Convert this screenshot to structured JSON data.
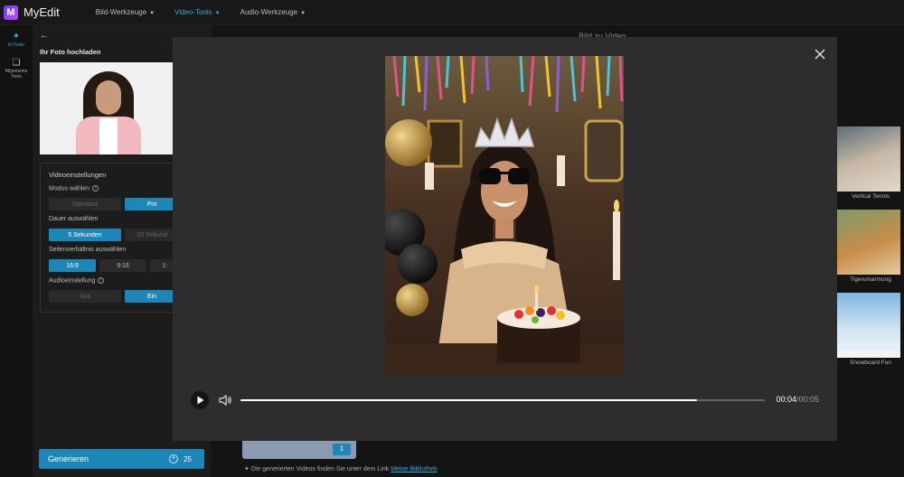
{
  "app": {
    "logo_letter": "M",
    "name": "MyEdit"
  },
  "nav": [
    {
      "label": "Bild-Werkzeuge",
      "active": false
    },
    {
      "label": "Video-Tools",
      "active": true
    },
    {
      "label": "Audio-Werkzeuge",
      "active": false
    }
  ],
  "rail": [
    {
      "label": "KI Tools",
      "icon": "magic-wand-icon",
      "active": true
    },
    {
      "label": "Allgemeine Tools",
      "icon": "layers-icon",
      "active": false
    }
  ],
  "panel": {
    "upload_title": "Ihr Foto hochladen",
    "settings_title": "Videoeinstellungen",
    "mode_label": "Modus wählen",
    "mode_options": [
      "Standard",
      "Pro"
    ],
    "duration_label": "Dauer auswählen",
    "duration_options": [
      "5 Sekunden",
      "10 Sekund"
    ],
    "aspect_label": "Seitenverhältnis auswählen",
    "aspect_options": [
      "16:9",
      "9:16",
      "1:"
    ],
    "audio_label": "Audioeinstellung",
    "audio_options": [
      "Aus",
      "Ein"
    ],
    "generate_label": "Generieren",
    "credits": "25"
  },
  "main": {
    "title": "Bild zu Video",
    "footnote_text": "Die generierten Videos finden Sie unter dem Link",
    "footnote_link": "Meine Bibliothek"
  },
  "templates": [
    {
      "label": "Vertical Tennis"
    },
    {
      "label": "Tigerumarmung"
    },
    {
      "label": "Snowboard Fun"
    }
  ],
  "player": {
    "current_time": "00:04",
    "total_time": "/00:05",
    "progress": 0.87
  },
  "colors": {
    "accent": "#1d86b8",
    "link": "#34a9dd",
    "modal_bg": "#2d2d2d"
  }
}
